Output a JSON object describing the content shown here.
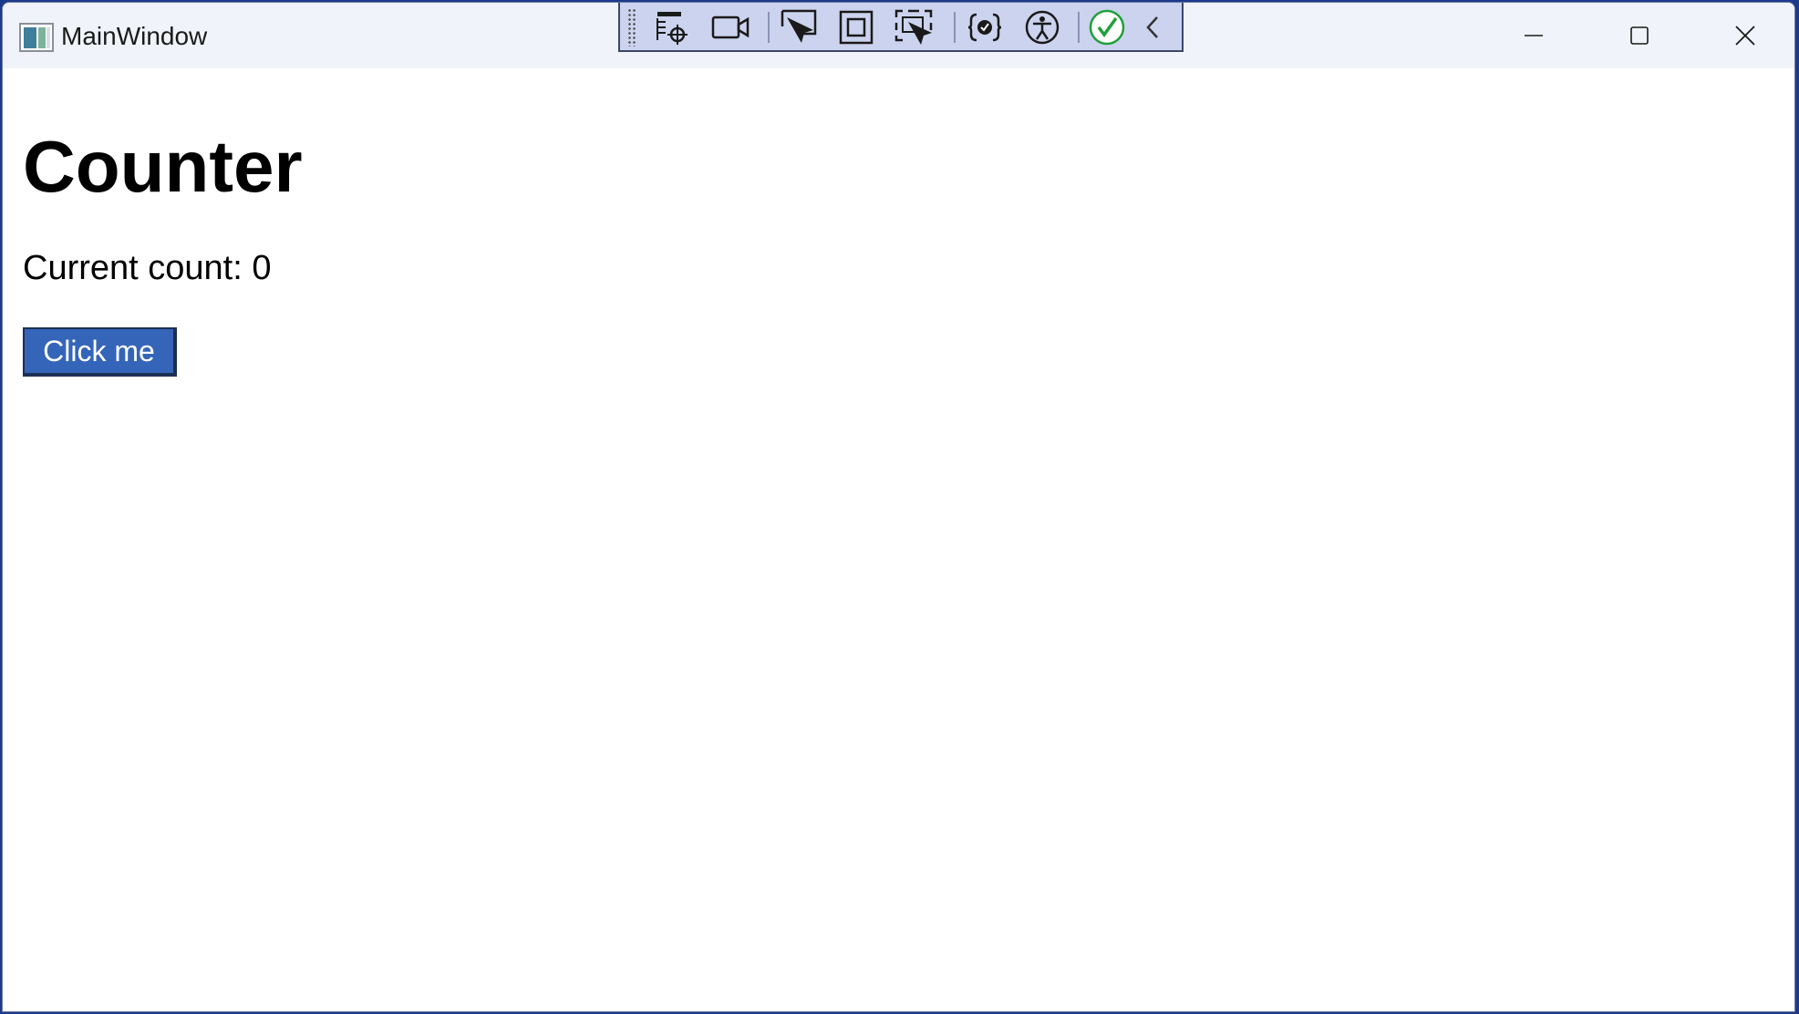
{
  "window": {
    "title": "MainWindow"
  },
  "dev_toolbar": {
    "tools": [
      "select-element-icon",
      "video-record-icon",
      "pointer-select-icon",
      "layout-frame-icon",
      "track-focus-icon",
      "binding-icon",
      "accessibility-icon",
      "check-ok-icon",
      "chevron-left-icon"
    ]
  },
  "page": {
    "heading": "Counter",
    "count_text": "Current count: 0",
    "button_label": "Click me"
  },
  "colors": {
    "button_bg": "#3465b8",
    "titlebar_bg": "#f0f3f9",
    "devbar_bg": "#ccd3ee",
    "check_green": "#1fa03a"
  }
}
